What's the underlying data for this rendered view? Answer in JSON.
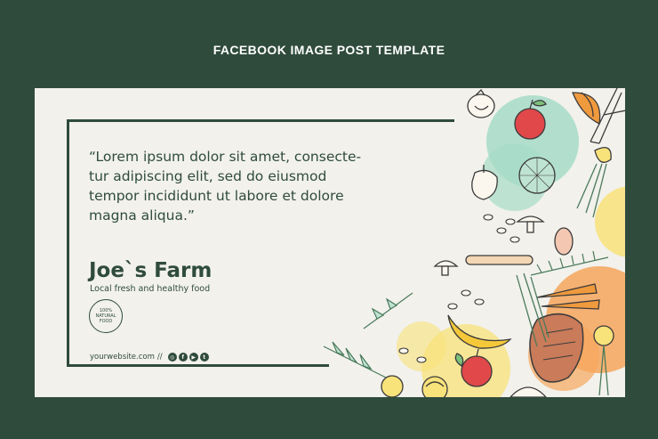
{
  "header": {
    "title": "FACEBOOK IMAGE POST TEMPLATE"
  },
  "post": {
    "quote": "“Lorem ipsum dolor sit amet, consecte-\ntur adipiscing elit, sed do eiusmod\ntempor incididunt ut labore et dolore\nmagna aliqua.”",
    "brand_name": "Joe`s Farm",
    "tagline": "Local fresh and healthy food",
    "badge": {
      "line1": "100%",
      "line2": "NATURAL",
      "line3": "FOOD"
    },
    "website": "yourwebsite.com",
    "separator": "//",
    "social_icons": [
      "instagram-icon",
      "facebook-icon",
      "youtube-icon",
      "twitter-icon"
    ]
  },
  "colors": {
    "background": "#2f4b3c",
    "card": "#f2f1ec",
    "text": "#2f4b3c",
    "accent_teal": "#9fd9c4",
    "accent_orange": "#f6a65d",
    "accent_yellow": "#f8e27a"
  }
}
